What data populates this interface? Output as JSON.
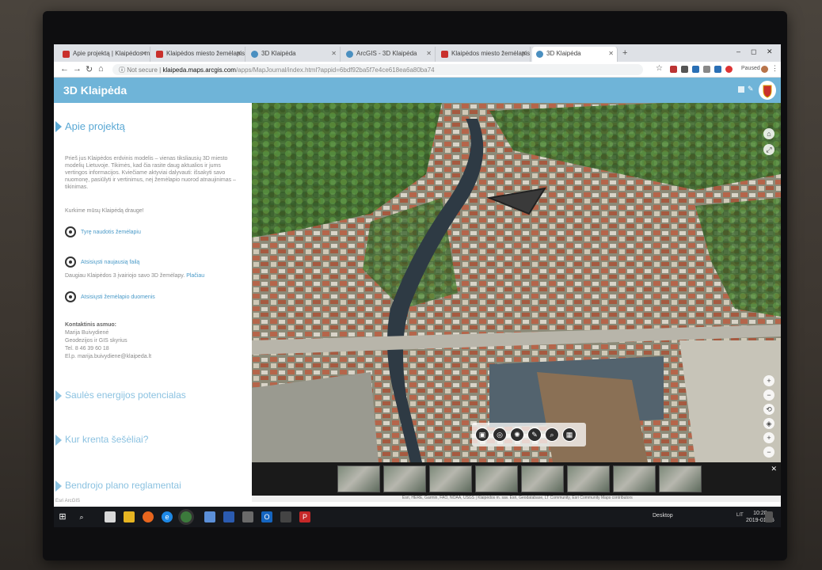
{
  "browser": {
    "tabs": [
      {
        "label": "Apie projektą | Klaipėdos miesto"
      },
      {
        "label": "Klaipėdos miesto žemėlapis | Kl"
      },
      {
        "label": "3D Klaipėda"
      },
      {
        "label": "ArcGIS - 3D Klaipėda"
      },
      {
        "label": "Klaipėdos miesto žemėlapis | Kl"
      },
      {
        "label": "3D Klaipėda"
      }
    ],
    "new_tab_symbol": "+",
    "not_secure_label": "Not secure",
    "url_domain": "klaipeda.maps.arcgis.com",
    "url_path": "/apps/MapJournal/index.html?appid=6bdf92ba5f7e4ce618ea6a80ba74",
    "profile_label": "Paused",
    "window_controls": [
      "–",
      "◻",
      "✕"
    ]
  },
  "app": {
    "title": "3D Klaipėda"
  },
  "panel": {
    "section_about": "Apie projektą",
    "intro_text": "Prieš jus Klaipėdos erdvinis modelis – vienas tiksliausių 3D miesto modelių Lietuvoje. Tikimės, kad čia rasite daug aktualios ir jums vertingos informacijos. Kviečiame aktyviai dalyvauti: išsakyti savo nuomonę, pasiūlyti ir vertinimus, neį žemėlapio nuorod atnaujinimas – tikinimas.",
    "call_text": "Kurkime mūsų Klaipėdą drauge!",
    "links": [
      {
        "label": "Tyrę naudotis žemėlapiu"
      },
      {
        "label": "Atsisiųsti naujausią failą"
      },
      {
        "label": "Atsisiųsti žemėlapio duomenis"
      }
    ],
    "note_text": "Daugiau Klaipėdos 3 įvairiojo savo 3D žemėlapy.",
    "note_link": "Plačiau",
    "contact_title": "Kontaktinis asmuo:",
    "contact_lines": [
      "Marija Buivydienė",
      "Geodezijos ir GIS skyrius",
      "Tel. 8 46 39 60 18",
      "El.p. marija.buivydiene@klaipeda.lt"
    ],
    "section_solar": "Saulės energijos potencialas",
    "section_shadows": "Kur krenta šešėliai?",
    "section_plan": "Bendrojo plano reglamentai",
    "powered_by": "Esri ArcGIS"
  },
  "map": {
    "attribution": "Esri, HERE, Garmin, FAO, NOAA, USGS | Klaipėdos m. sav. Esri, Geodatabase, LT Community, Esri Community Maps contributors"
  },
  "taskbar": {
    "desktop_label": "Desktop",
    "lang": "LIT",
    "time": "10:28",
    "date": "2019-01-25"
  }
}
